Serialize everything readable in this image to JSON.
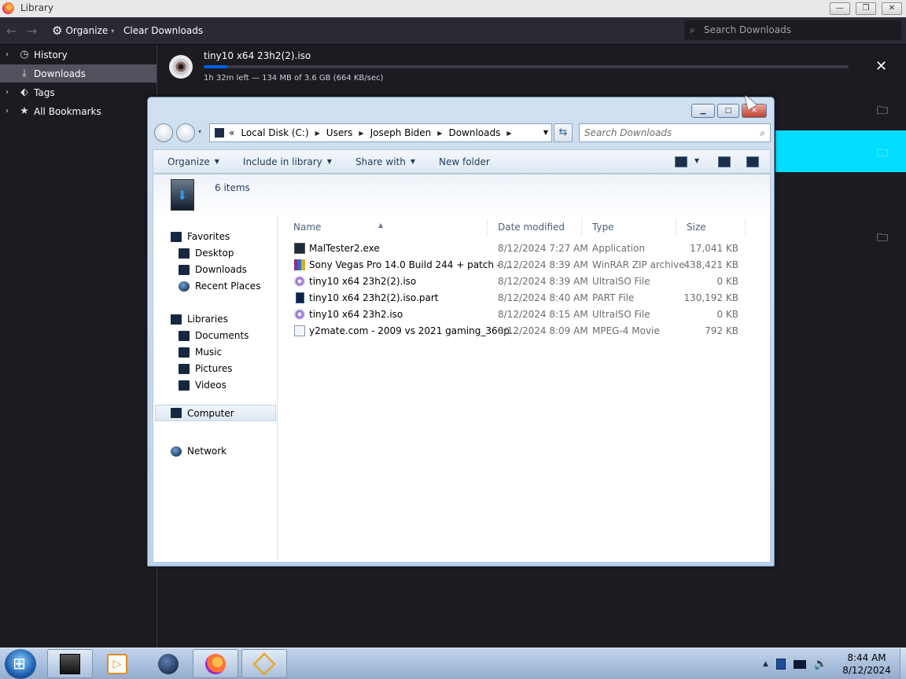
{
  "firefox": {
    "title": "Library",
    "toolbar": {
      "organize_label": "Organize",
      "clear_label": "Clear Downloads"
    },
    "search_placeholder": "Search Downloads",
    "sidebar": [
      {
        "label": "History",
        "icon": "clock-icon"
      },
      {
        "label": "Downloads",
        "icon": "download-icon",
        "selected": true
      },
      {
        "label": "Tags",
        "icon": "tag-icon"
      },
      {
        "label": "All Bookmarks",
        "icon": "star-icon"
      }
    ],
    "download": {
      "filename": "tiny10 x64 23h2(2).iso",
      "status": "1h 32m left — 134 MB of 3.6 GB (664 KB/sec)",
      "progress": 0.036
    }
  },
  "explorer": {
    "breadcrumb": [
      "Local Disk (C:)",
      "Users",
      "Joseph Biden",
      "Downloads"
    ],
    "breadcrumb_prefix": "«",
    "search_placeholder": "Search Downloads",
    "commands": [
      "Organize",
      "Include in library",
      "Share with",
      "New folder"
    ],
    "item_count": "6 items",
    "nav": {
      "favorites": {
        "label": "Favorites",
        "items": [
          "Desktop",
          "Downloads",
          "Recent Places"
        ]
      },
      "libraries": {
        "label": "Libraries",
        "items": [
          "Documents",
          "Music",
          "Pictures",
          "Videos"
        ]
      },
      "computer": "Computer",
      "network": "Network"
    },
    "columns": [
      "Name",
      "Date modified",
      "Type",
      "Size"
    ],
    "files": [
      {
        "name": "MalTester2.exe",
        "date": "8/12/2024 7:27 AM",
        "type": "Application",
        "size": "17,041 KB",
        "icon": "exe-icon"
      },
      {
        "name": "Sony Vegas Pro 14.0 Build 244 + patch - ...",
        "date": "8/12/2024 8:39 AM",
        "type": "WinRAR ZIP archive",
        "size": "438,421 KB",
        "icon": "winrar-icon"
      },
      {
        "name": "tiny10 x64 23h2(2).iso",
        "date": "8/12/2024 8:39 AM",
        "type": "UltraISO File",
        "size": "0 KB",
        "icon": "disc-icon"
      },
      {
        "name": "tiny10 x64 23h2(2).iso.part",
        "date": "8/12/2024 8:40 AM",
        "type": "PART File",
        "size": "130,192 KB",
        "icon": "part-file-icon"
      },
      {
        "name": "tiny10 x64 23h2.iso",
        "date": "8/12/2024 8:15 AM",
        "type": "UltraISO File",
        "size": "0 KB",
        "icon": "disc-icon"
      },
      {
        "name": "y2mate.com - 2009 vs 2021 gaming_360p...",
        "date": "8/12/2024 8:09 AM",
        "type": "MPEG-4 Movie",
        "size": "792 KB",
        "icon": "video-file-icon"
      }
    ]
  },
  "taskbar": {
    "apps": [
      "explorer-icon",
      "media-player-icon",
      "network-globe-icon",
      "firefox-icon",
      "virtualbox-icon"
    ],
    "clock_time": "8:44 AM",
    "clock_date": "8/12/2024"
  },
  "colors": {
    "firefox_bg": "#1c1b22",
    "highlight": "#00ddff",
    "progress": "#0060df",
    "win7_frame": "#bcd2e9"
  }
}
